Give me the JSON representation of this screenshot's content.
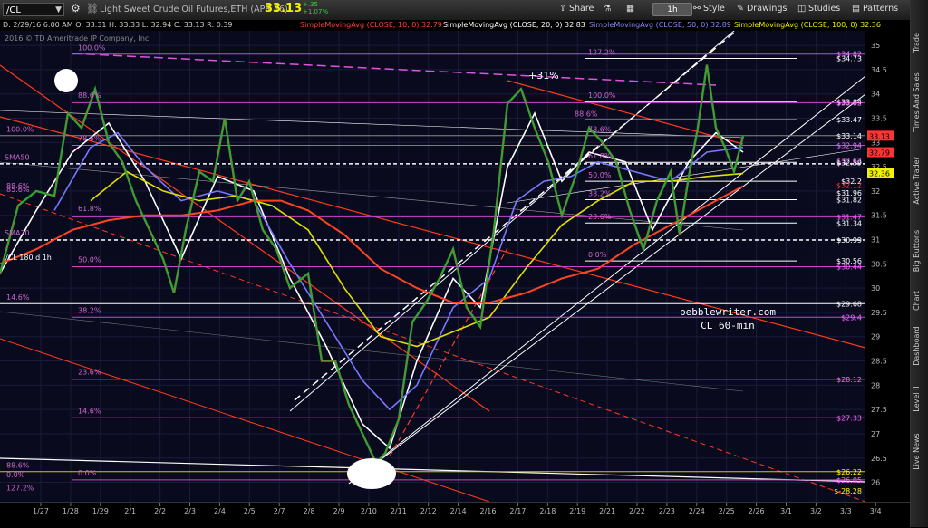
{
  "toolbar": {
    "symbol": "/CL",
    "description": "Light Sweet Crude Oil Futures,ETH (APR 16)",
    "last_price": "33.13",
    "change": "+.35",
    "change_pct": "+1.07%",
    "share": "Share",
    "timeframe": "1h",
    "style": "Style",
    "drawings": "Drawings",
    "studies": "Studies",
    "patterns": "Patterns"
  },
  "study_header": {
    "ohlc": "D: 2/29/16 6:00 AM O: 33.31 H: 33.33 L: 32.94 C: 33.13 R: 0.39",
    "sma10": "SimpleMovingAvg (CLOSE, 10, 0) 32.79",
    "sma20": "SimpleMovingAvg (CLOSE, 20, 0) 32.83",
    "sma50": "SimpleMovingAvg (CLOSE, 50, 0) 32.89",
    "sma100": "SimpleMovingAvg (CLOSE, 100, 0) 32.36",
    "colors": {
      "sma10": "#ff4040",
      "sma20": "#ffffff",
      "sma50": "#8888ff",
      "sma100": "#f0f000"
    }
  },
  "sidebar_tabs": [
    "Trade",
    "Times And Sales",
    "Active Trader",
    "Big Buttons",
    "Chart",
    "Dashboard",
    "Level II",
    "Live News"
  ],
  "copyright": "2016 © TD Ameritrade IP Company, Inc.",
  "chart_label": "/CL 180 d 1h",
  "watermark": {
    "line1": "pebblewriter.com",
    "line2": "CL 60-min"
  },
  "annotation_pct": "+31%",
  "chart_data": {
    "type": "line",
    "ylim": [
      25.6,
      35.3
    ],
    "y_ticks": [
      26,
      26.5,
      27,
      27.5,
      28,
      28.5,
      29,
      29.5,
      30,
      30.5,
      31,
      31.5,
      32,
      32.5,
      33,
      33.5,
      34,
      34.5,
      35
    ],
    "x_tick_labels": [
      "1/27",
      "1/28",
      "1/29",
      "2/1",
      "2/2",
      "2/3",
      "2/4",
      "2/5",
      "2/7",
      "2/8",
      "2/9",
      "2/10",
      "2/11",
      "2/12",
      "2/14",
      "2/16",
      "2/17",
      "2/18",
      "2/19",
      "2/21",
      "2/22",
      "2/23",
      "2/24",
      "2/25",
      "2/26",
      "3/1",
      "3/2",
      "3/3",
      "3/4"
    ],
    "axis_price_labels": [
      {
        "v": 34.82,
        "label": "$34.82",
        "color": "#ff66ff"
      },
      {
        "v": 34.73,
        "label": "$34.73",
        "color": "#ffffff"
      },
      {
        "v": 33.84,
        "label": "$33.84",
        "color": "#ffffff"
      },
      {
        "v": 33.82,
        "label": "$33.82",
        "color": "#ff66ff"
      },
      {
        "v": 33.47,
        "label": "$33.47",
        "color": "#ffffff"
      },
      {
        "v": 33.14,
        "label": "$33.14",
        "color": "#ffffff"
      },
      {
        "v": 32.94,
        "label": "$32.94",
        "color": "#ff66ff"
      },
      {
        "v": 32.62,
        "label": "$32.62",
        "color": "#ff66ff"
      },
      {
        "v": 32.59,
        "label": "$32.59",
        "color": "#ffffff"
      },
      {
        "v": 32.2,
        "label": "$32.2",
        "color": "#ffffff"
      },
      {
        "v": 32.12,
        "label": "$32.12",
        "color": "#ff3333"
      },
      {
        "v": 31.96,
        "label": "$31.96",
        "color": "#ffffff"
      },
      {
        "v": 31.82,
        "label": "$31.82",
        "color": "#ffffff"
      },
      {
        "v": 31.47,
        "label": "$31.47",
        "color": "#ff66ff"
      },
      {
        "v": 31.34,
        "label": "$31.34",
        "color": "#ffffff"
      },
      {
        "v": 30.99,
        "label": "$30.99",
        "color": "#ffffff"
      },
      {
        "v": 30.56,
        "label": "$30.56",
        "color": "#ffffff"
      },
      {
        "v": 30.44,
        "label": "$30.44",
        "color": "#ff66ff"
      },
      {
        "v": 29.68,
        "label": "$29.68",
        "color": "#ffffff"
      },
      {
        "v": 29.4,
        "label": "$29.4",
        "color": "#ff66ff"
      },
      {
        "v": 28.12,
        "label": "$28.12",
        "color": "#ff66ff"
      },
      {
        "v": 27.33,
        "label": "$27.33",
        "color": "#ff66ff"
      },
      {
        "v": 26.22,
        "label": "$26.22",
        "color": "#ffff00"
      },
      {
        "v": 26.05,
        "label": "$26.05",
        "color": "#ff66ff"
      },
      {
        "v": 25.82,
        "label": "$-28.28",
        "color": "#ffff00"
      }
    ],
    "price_badges": [
      {
        "v": 33.13,
        "label": "33.13",
        "bg": "#ff3333"
      },
      {
        "v": 32.79,
        "label": "32.79",
        "bg": "#ff3333"
      },
      {
        "v": 32.36,
        "label": "32.36",
        "bg": "#f0f000"
      }
    ],
    "fib_labels": [
      {
        "text": "100.0%",
        "x": 86,
        "v": 34.86
      },
      {
        "text": "88.6%",
        "x": 86,
        "v": 33.88
      },
      {
        "text": "78.6%",
        "x": 86,
        "v": 33.0
      },
      {
        "text": "61.8%",
        "x": 86,
        "v": 31.55
      },
      {
        "text": "50.0%",
        "x": 86,
        "v": 30.5
      },
      {
        "text": "38.2%",
        "x": 86,
        "v": 29.45
      },
      {
        "text": "23.6%",
        "x": 86,
        "v": 28.18
      },
      {
        "text": "14.6%",
        "x": 86,
        "v": 27.38
      },
      {
        "text": "0.0%",
        "x": 86,
        "v": 26.1
      },
      {
        "text": "100.0%",
        "x": 7,
        "v": 33.18
      },
      {
        "text": "88.6%",
        "x": 7,
        "v": 32.02
      },
      {
        "text": "85.6%",
        "x": 7,
        "v": 31.94
      },
      {
        "text": "14.6%",
        "x": 7,
        "v": 29.72
      },
      {
        "text": "88.6%",
        "x": 7,
        "v": 26.26
      },
      {
        "text": "0.0%",
        "x": 7,
        "v": 26.07
      },
      {
        "text": "127.2%",
        "x": 7,
        "v": 25.8
      },
      {
        "text": "127.2%",
        "x": 649,
        "v": 34.77
      },
      {
        "text": "100.0%",
        "x": 649,
        "v": 33.88
      },
      {
        "text": "88.6%",
        "x": 634,
        "v": 33.5
      },
      {
        "text": "78.6%",
        "x": 649,
        "v": 33.18
      },
      {
        "text": "61.8%",
        "x": 649,
        "v": 32.63
      },
      {
        "text": "50.0%",
        "x": 649,
        "v": 32.24
      },
      {
        "text": "38.2%",
        "x": 649,
        "v": 31.86
      },
      {
        "text": "23.6%",
        "x": 649,
        "v": 31.38
      },
      {
        "text": "0.0%",
        "x": 649,
        "v": 30.6
      },
      {
        "text": "SMA50",
        "x": 5,
        "v": 32.6
      },
      {
        "text": "SMA20",
        "x": 5,
        "v": 31.05
      }
    ],
    "fib_lines": [
      {
        "v": 34.82,
        "x1": 80,
        "x2": 955,
        "color": "#cc44cc"
      },
      {
        "v": 33.82,
        "x1": 80,
        "x2": 955,
        "color": "#cc44cc"
      },
      {
        "v": 32.94,
        "x1": 80,
        "x2": 955,
        "color": "#cc44cc"
      },
      {
        "v": 31.47,
        "x1": 80,
        "x2": 955,
        "color": "#cc44cc"
      },
      {
        "v": 30.44,
        "x1": 80,
        "x2": 955,
        "color": "#cc44cc"
      },
      {
        "v": 29.4,
        "x1": 80,
        "x2": 955,
        "color": "#cc44cc"
      },
      {
        "v": 28.12,
        "x1": 80,
        "x2": 955,
        "color": "#cc44cc"
      },
      {
        "v": 27.33,
        "x1": 80,
        "x2": 955,
        "color": "#cc44cc"
      },
      {
        "v": 26.05,
        "x1": 80,
        "x2": 955,
        "color": "#cc44cc"
      },
      {
        "v": 26.22,
        "x1": 0,
        "x2": 955,
        "color": "#cccc00"
      },
      {
        "v": 34.73,
        "x1": 645,
        "x2": 880,
        "color": "#ffffff"
      },
      {
        "v": 33.84,
        "x1": 645,
        "x2": 880,
        "color": "#ffffff"
      },
      {
        "v": 33.47,
        "x1": 645,
        "x2": 880,
        "color": "#ffffff"
      },
      {
        "v": 33.14,
        "x1": 0,
        "x2": 955,
        "color": "#888888"
      },
      {
        "v": 32.59,
        "x1": 645,
        "x2": 880,
        "color": "#ffffff"
      },
      {
        "v": 32.2,
        "x1": 645,
        "x2": 880,
        "color": "#ffffff"
      },
      {
        "v": 31.82,
        "x1": 645,
        "x2": 880,
        "color": "#ffffff"
      },
      {
        "v": 31.34,
        "x1": 645,
        "x2": 880,
        "color": "#ffffff"
      },
      {
        "v": 30.56,
        "x1": 645,
        "x2": 880,
        "color": "#ffffff"
      },
      {
        "v": 29.68,
        "x1": 0,
        "x2": 955,
        "color": "#ffffff"
      }
    ],
    "dashed_levels": [
      {
        "v": 32.56,
        "color": "#ffffff"
      },
      {
        "v": 30.99,
        "color": "#ffffff"
      }
    ],
    "price_path": [
      [
        0,
        30.3
      ],
      [
        20,
        31.7
      ],
      [
        40,
        32.0
      ],
      [
        60,
        31.9
      ],
      [
        75,
        33.6
      ],
      [
        90,
        33.3
      ],
      [
        105,
        34.1
      ],
      [
        120,
        33.0
      ],
      [
        135,
        32.6
      ],
      [
        150,
        31.8
      ],
      [
        165,
        31.2
      ],
      [
        180,
        30.6
      ],
      [
        192,
        29.9
      ],
      [
        205,
        31.2
      ],
      [
        220,
        32.4
      ],
      [
        235,
        32.2
      ],
      [
        248,
        33.5
      ],
      [
        262,
        31.8
      ],
      [
        275,
        32.2
      ],
      [
        290,
        31.2
      ],
      [
        305,
        30.8
      ],
      [
        320,
        30.0
      ],
      [
        340,
        30.3
      ],
      [
        355,
        28.5
      ],
      [
        370,
        28.5
      ],
      [
        385,
        27.6
      ],
      [
        400,
        27.0
      ],
      [
        415,
        26.4
      ],
      [
        425,
        26.6
      ],
      [
        440,
        27.3
      ],
      [
        455,
        29.3
      ],
      [
        470,
        29.7
      ],
      [
        485,
        30.2
      ],
      [
        500,
        30.8
      ],
      [
        515,
        29.6
      ],
      [
        530,
        29.2
      ],
      [
        545,
        31.2
      ],
      [
        560,
        33.8
      ],
      [
        575,
        34.1
      ],
      [
        590,
        33.3
      ],
      [
        605,
        32.6
      ],
      [
        620,
        31.5
      ],
      [
        635,
        32.3
      ],
      [
        650,
        33.3
      ],
      [
        665,
        33.0
      ],
      [
        680,
        32.6
      ],
      [
        695,
        31.6
      ],
      [
        710,
        30.8
      ],
      [
        725,
        31.8
      ],
      [
        740,
        32.4
      ],
      [
        750,
        31.1
      ],
      [
        760,
        32.3
      ],
      [
        770,
        33.3
      ],
      [
        780,
        34.6
      ],
      [
        790,
        33.3
      ],
      [
        800,
        32.9
      ],
      [
        810,
        32.4
      ],
      [
        820,
        33.13
      ]
    ],
    "sma_paths": [
      {
        "name": "SMA20",
        "color": "#ffffff",
        "points": [
          [
            0,
            30.3
          ],
          [
            40,
            31.6
          ],
          [
            80,
            32.8
          ],
          [
            120,
            33.4
          ],
          [
            160,
            32.2
          ],
          [
            200,
            30.6
          ],
          [
            240,
            32.3
          ],
          [
            280,
            32.0
          ],
          [
            320,
            30.2
          ],
          [
            360,
            28.8
          ],
          [
            400,
            27.2
          ],
          [
            430,
            26.7
          ],
          [
            460,
            28.5
          ],
          [
            500,
            30.2
          ],
          [
            530,
            29.6
          ],
          [
            560,
            32.5
          ],
          [
            590,
            33.6
          ],
          [
            620,
            32.2
          ],
          [
            650,
            32.8
          ],
          [
            690,
            32.6
          ],
          [
            720,
            31.2
          ],
          [
            760,
            32.6
          ],
          [
            790,
            33.2
          ],
          [
            820,
            32.8
          ]
        ]
      },
      {
        "name": "SMA50",
        "color": "#7878ff",
        "points": [
          [
            60,
            31.6
          ],
          [
            100,
            32.9
          ],
          [
            130,
            33.2
          ],
          [
            160,
            32.5
          ],
          [
            200,
            31.8
          ],
          [
            240,
            32.0
          ],
          [
            280,
            31.8
          ],
          [
            320,
            30.5
          ],
          [
            360,
            29.3
          ],
          [
            400,
            28.1
          ],
          [
            430,
            27.5
          ],
          [
            460,
            28.0
          ],
          [
            500,
            29.6
          ],
          [
            540,
            30.2
          ],
          [
            570,
            31.8
          ],
          [
            600,
            32.2
          ],
          [
            630,
            32.3
          ],
          [
            660,
            32.6
          ],
          [
            700,
            32.4
          ],
          [
            740,
            32.2
          ],
          [
            780,
            32.8
          ],
          [
            820,
            32.9
          ]
        ]
      },
      {
        "name": "SMA100",
        "color": "#e0e000",
        "points": [
          [
            100,
            31.8
          ],
          [
            140,
            32.4
          ],
          [
            180,
            32.0
          ],
          [
            220,
            31.8
          ],
          [
            260,
            31.9
          ],
          [
            300,
            31.7
          ],
          [
            340,
            31.2
          ],
          [
            380,
            30.0
          ],
          [
            420,
            29.0
          ],
          [
            460,
            28.8
          ],
          [
            500,
            29.1
          ],
          [
            540,
            29.4
          ],
          [
            580,
            30.4
          ],
          [
            620,
            31.3
          ],
          [
            660,
            31.8
          ],
          [
            700,
            32.2
          ],
          [
            740,
            32.2
          ],
          [
            780,
            32.3
          ],
          [
            820,
            32.36
          ]
        ]
      },
      {
        "name": "SMA200",
        "color": "#ff4422",
        "points": [
          [
            0,
            30.5
          ],
          [
            40,
            30.8
          ],
          [
            80,
            31.2
          ],
          [
            120,
            31.4
          ],
          [
            160,
            31.5
          ],
          [
            200,
            31.5
          ],
          [
            240,
            31.6
          ],
          [
            280,
            31.8
          ],
          [
            310,
            31.8
          ],
          [
            340,
            31.6
          ],
          [
            380,
            31.1
          ],
          [
            420,
            30.4
          ],
          [
            460,
            30.0
          ],
          [
            500,
            29.7
          ],
          [
            540,
            29.7
          ],
          [
            580,
            29.9
          ],
          [
            620,
            30.2
          ],
          [
            660,
            30.4
          ],
          [
            700,
            30.9
          ],
          [
            740,
            31.3
          ],
          [
            780,
            31.7
          ],
          [
            820,
            32.1
          ]
        ]
      }
    ]
  }
}
